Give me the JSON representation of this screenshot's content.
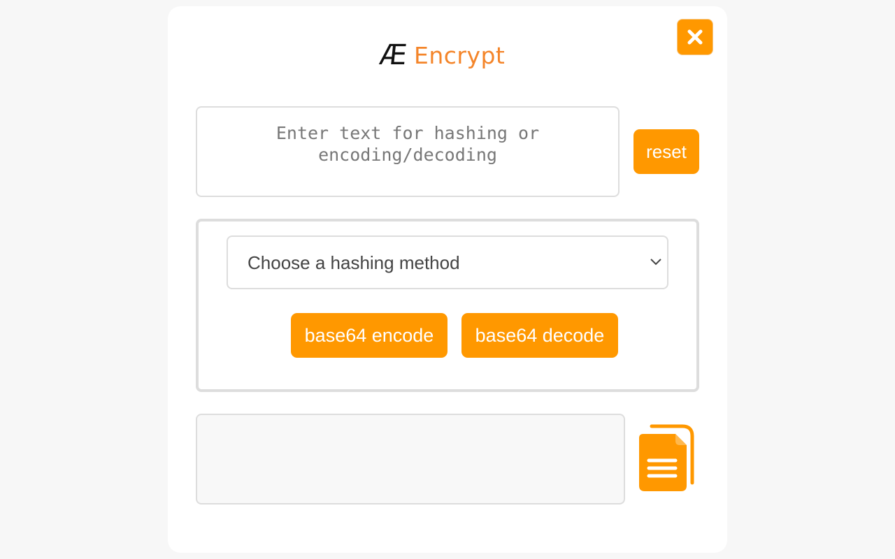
{
  "brand": {
    "mark": "Æ",
    "name": "Encrypt",
    "accent": "#ff9800",
    "logo_text_color": "#f4852a"
  },
  "header": {
    "close_icon": "close-icon"
  },
  "input": {
    "placeholder": "Enter text for hashing or encoding/decoding",
    "value": ""
  },
  "reset_label": "reset",
  "hashing": {
    "selected": "Choose a hashing method",
    "dropdown_icon": "chevron-down-icon"
  },
  "buttons": {
    "encode": "base64 encode",
    "decode": "base64 decode"
  },
  "output": {
    "value": "",
    "copy_icon": "copy-icon"
  }
}
